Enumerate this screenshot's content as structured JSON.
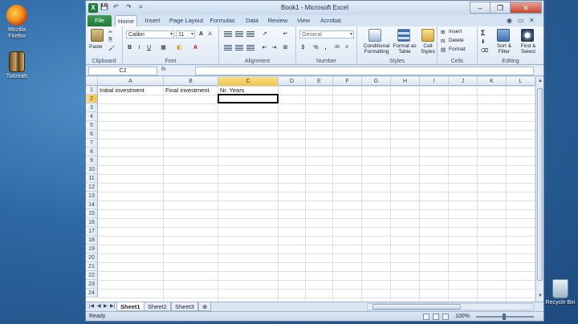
{
  "desktop": {
    "icons": [
      {
        "label": "Mozilla Firefox"
      },
      {
        "label": "Tutorials"
      },
      {
        "label": "Recycle Bin"
      }
    ]
  },
  "window": {
    "title": "Book1 - Microsoft Excel",
    "app_icon": "X",
    "qat": {
      "save": "💾",
      "undo": "↶",
      "redo": "↷",
      "more": "="
    }
  },
  "tabs": [
    "File",
    "Home",
    "Insert",
    "Page Layout",
    "Formulas",
    "Data",
    "Review",
    "View",
    "Acrobat"
  ],
  "active_tab": "Home",
  "ribbon": {
    "clipboard": {
      "label": "Clipboard",
      "paste": "Paste"
    },
    "font": {
      "label": "Font",
      "name": "Calibri",
      "size": "11",
      "bold": "B",
      "italic": "I",
      "underline": "U",
      "grow": "A",
      "shrink": "A"
    },
    "alignment": {
      "label": "Alignment"
    },
    "number": {
      "label": "Number",
      "format": "General",
      "currency": "$",
      "percent": "%",
      "comma": ",",
      "inc_dec": ".00",
      "dec_dec": ".0"
    },
    "styles": {
      "label": "Styles",
      "conditional": "Conditional Formatting",
      "format_table": "Format as Table",
      "cell_styles": "Cell Styles"
    },
    "cells": {
      "label": "Cells",
      "insert": "Insert",
      "delete": "Delete",
      "format": "Format"
    },
    "editing": {
      "label": "Editing",
      "sum": "Σ",
      "sort": "Sort & Filter",
      "find": "Find & Select"
    }
  },
  "formula_bar": {
    "name_box": "C2",
    "fx": "fx",
    "value": ""
  },
  "grid": {
    "columns": [
      "A",
      "B",
      "C",
      "D",
      "E",
      "F",
      "G",
      "H",
      "I",
      "J",
      "K",
      "L"
    ],
    "rows": [
      "1",
      "2",
      "3",
      "4",
      "5",
      "6",
      "7",
      "8",
      "9",
      "10",
      "11",
      "12",
      "13",
      "14",
      "15",
      "16",
      "17",
      "18",
      "19",
      "20",
      "21",
      "22",
      "23",
      "24"
    ],
    "selected_col": "C",
    "selected_row": "2",
    "cells": {
      "A1": "Initial investment",
      "B1": "Final investment",
      "C1": "Nr. Years"
    }
  },
  "sheets": [
    "Sheet1",
    "Sheet2",
    "Sheet3"
  ],
  "active_sheet": "Sheet1",
  "status": {
    "text": "Ready",
    "zoom": "100%"
  },
  "colors": {
    "accent": "#21793a",
    "selection": "#f1c34a"
  }
}
